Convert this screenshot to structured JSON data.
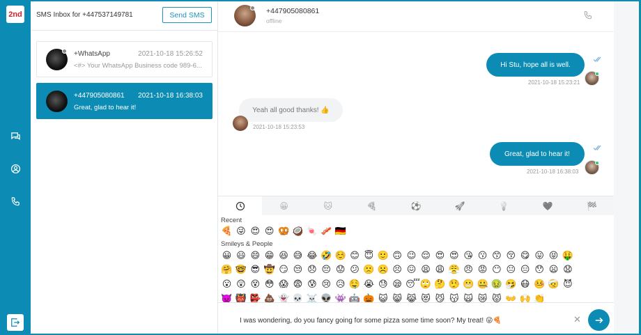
{
  "app": {
    "logo_text": "2nd"
  },
  "rail": {
    "icons": [
      "chat-bubbles-icon",
      "user-circle-icon",
      "phone-icon",
      "logout-icon"
    ]
  },
  "inbox": {
    "title": "SMS Inbox for +447537149781",
    "send_label": "Send SMS",
    "conversations": [
      {
        "name": "+WhatsApp",
        "time": "2021-10-18 15:26:52",
        "preview": "<#> Your WhatsApp Business code 989-6...",
        "active": false
      },
      {
        "name": "+447905080861",
        "time": "2021-10-18 16:38:03",
        "preview": "Great, glad to hear it!",
        "active": true
      }
    ]
  },
  "chat": {
    "contact_name": "+447905080861",
    "contact_status": "offline",
    "messages": [
      {
        "direction": "out",
        "text": "Hi Stu, hope all is well.",
        "time": "2021-10-18 15:23:21"
      },
      {
        "direction": "in",
        "text": "Yeah all good thanks! 👍",
        "time": "2021-10-18 15:23:53"
      },
      {
        "direction": "out",
        "text": "Great, glad to hear it!",
        "time": "2021-10-18 16:38:03"
      }
    ]
  },
  "emoji_picker": {
    "tabs": [
      "🕒",
      "😀",
      "🐱",
      "🍕",
      "⚽",
      "🚀",
      "💡",
      "🖤",
      "🏁"
    ],
    "recent_label": "Recent",
    "recent": [
      "🍕",
      "😜",
      "😍",
      "😍",
      "🥨",
      "🥥",
      "🍬",
      "🥓",
      "🇩🇪"
    ],
    "smileys_label": "Smileys & People",
    "smileys_rows": [
      [
        "😀",
        "😃",
        "😄",
        "😁",
        "😆",
        "😅",
        "😂",
        "🤣",
        "☺️",
        "😊",
        "😇",
        "🙂",
        "🙃",
        "😉",
        "😌",
        "😍",
        "😍",
        "😘",
        "😗",
        "😙",
        "😚",
        "😋",
        "😛",
        "😝",
        "🤑"
      ],
      [
        "🤗",
        "🤓",
        "😎",
        "🤠",
        "😏",
        "😒",
        "😞",
        "😔",
        "😟",
        "😕",
        "🙁",
        "☹️",
        "😣",
        "😖",
        "😫",
        "😩",
        "😤",
        "😠",
        "😡",
        "😶",
        "😐",
        "😑",
        "😯",
        "😦",
        "😧"
      ],
      [
        "😮",
        "😲",
        "😵",
        "😳",
        "😱",
        "😨",
        "😰",
        "😢",
        "😥",
        "🤤",
        "😭",
        "😓",
        "😪",
        "😴",
        "🙄",
        "🤔",
        "🤥",
        "😬",
        "🤐",
        "🤢",
        "🤧",
        "😷",
        "🤒",
        "🤕",
        "😈"
      ],
      [
        "👿",
        "👹",
        "👺",
        "💩",
        "👻",
        "💀",
        "☠️",
        "👽",
        "👾",
        "🤖",
        "🎃",
        "😺",
        "😸",
        "😹",
        "😻",
        "😼",
        "😽",
        "🙀",
        "😿",
        "😾",
        "👐",
        "🙌",
        "👏"
      ]
    ]
  },
  "composer": {
    "value": "I was wondering, do you fancy going for some pizza some time soon? My treat! 😜🍕"
  }
}
